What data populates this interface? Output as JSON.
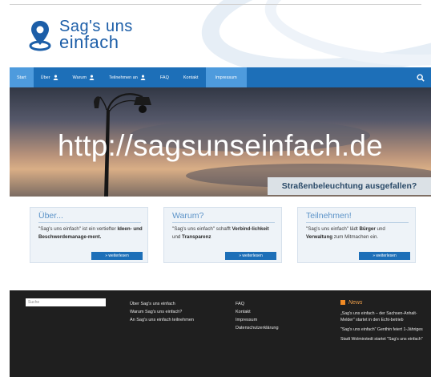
{
  "logo": {
    "line1": "Sag's uns",
    "line2": "einfach"
  },
  "nav": {
    "items": [
      {
        "label": "Start",
        "active": true
      },
      {
        "label": "Über",
        "person": true
      },
      {
        "label": "Warum",
        "person": true
      },
      {
        "label": "Teilnehmen an",
        "person": true
      },
      {
        "label": "FAQ"
      },
      {
        "label": "Kontakt"
      },
      {
        "label": "Impressum",
        "active": true
      }
    ]
  },
  "hero": {
    "watermark": "http://sagsunseinfach.de",
    "banner": "Straßenbeleuchtung ausgefallen?"
  },
  "boxes": [
    {
      "title": "Über...",
      "text_a": "\"Sag's uns einfach\" ist ein vertiefter ",
      "bold_a": "Ideen- und Beschwerdemanage-ment.",
      "text_b": "",
      "bold_b": "",
      "text_c": "",
      "more": "» weiterlesen"
    },
    {
      "title": "Warum?",
      "text_a": "\"Sag's uns einfach\" schafft ",
      "bold_a": "Verbind-lichkeit",
      "text_b": " und ",
      "bold_b": "Transparenz",
      "text_c": "",
      "more": "» weiterlesen"
    },
    {
      "title": "Teilnehmen!",
      "text_a": "\"Sag's uns einfach\" lädt ",
      "bold_a": "Bürger",
      "text_b": " und ",
      "bold_b": "Verwaltung",
      "text_c": " zum Mitmachen ein.",
      "more": "» weiterlesen"
    }
  ],
  "footer": {
    "search_placeholder": "Suche",
    "col1": [
      "Über Sag's uns einfach",
      "Warum Sag's uns einfach?",
      "An Sag's uns einfach teilnehmen"
    ],
    "col2": [
      "FAQ",
      "Kontakt",
      "Impressum",
      "Datenschutzerklärung"
    ],
    "news_title": "News",
    "news": [
      "„Sag's uns einfach – der Sachsen-Anhalt-Melder\" startet in den Echt-betrieb",
      "\"Sag's uns einfach\" Genthin feiert 1-Jähriges",
      "Stadt Wolmirstedt startet \"Sag's uns einfach\""
    ]
  },
  "colors": {
    "brand_blue": "#1d6fb8",
    "nav_active": "#4e9bdd",
    "footer_bg": "#1f1f1f",
    "news_orange": "#f08a24"
  },
  "icons": {
    "logo": "location-pin-icon",
    "nav_person": "person-icon",
    "search": "search-icon",
    "news": "rss-icon"
  }
}
